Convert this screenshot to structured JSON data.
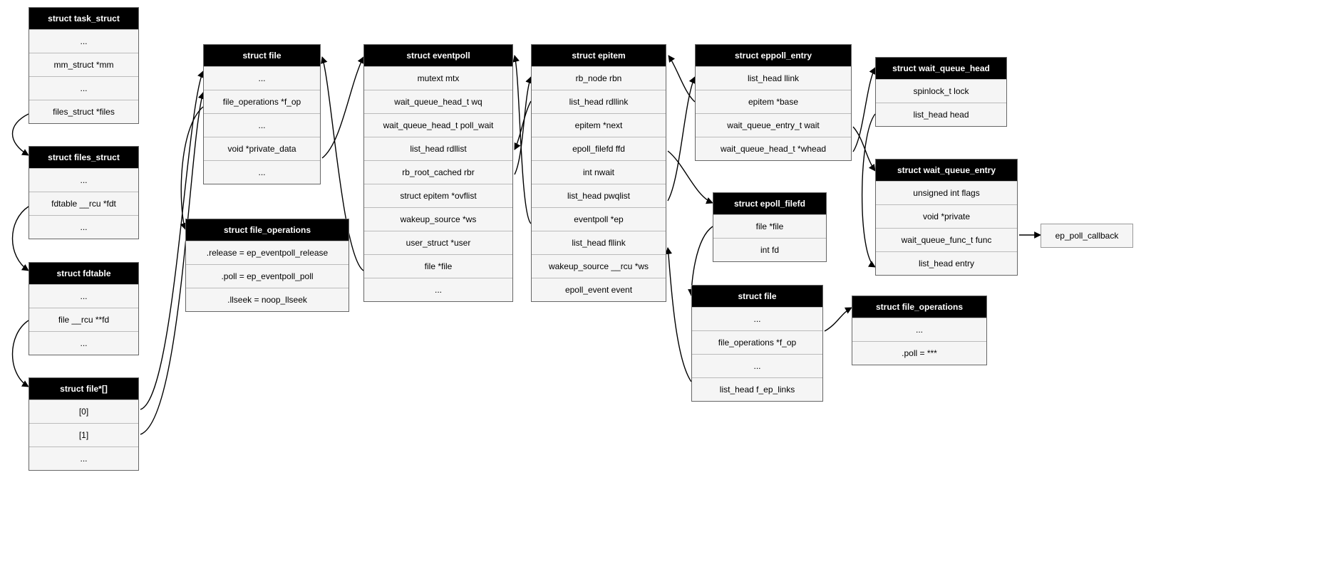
{
  "structs": {
    "task_struct": {
      "title": "struct task_struct",
      "fields": [
        "...",
        "mm_struct *mm",
        "...",
        "files_struct *files"
      ]
    },
    "files_struct": {
      "title": "struct files_struct",
      "fields": [
        "...",
        "fdtable __rcu *fdt",
        "..."
      ]
    },
    "fdtable": {
      "title": "struct fdtable",
      "fields": [
        "...",
        "file __rcu **fd",
        "..."
      ]
    },
    "file_array": {
      "title": "struct file*[]",
      "fields": [
        "[0]",
        "[1]",
        "..."
      ]
    },
    "file_1": {
      "title": "struct file",
      "fields": [
        "...",
        "file_operations *f_op",
        "...",
        "void *private_data",
        "..."
      ]
    },
    "file_operations_1": {
      "title": "struct file_operations",
      "fields": [
        ".release = ep_eventpoll_release",
        ".poll = ep_eventpoll_poll",
        ".llseek = noop_llseek"
      ]
    },
    "eventpoll": {
      "title": "struct eventpoll",
      "fields": [
        "mutext mtx",
        "wait_queue_head_t wq",
        "wait_queue_head_t poll_wait",
        "list_head rdllist",
        "rb_root_cached rbr",
        "struct epitem *ovflist",
        "wakeup_source *ws",
        "user_struct *user",
        "file *file",
        "..."
      ]
    },
    "epitem": {
      "title": "struct epitem",
      "fields": [
        "rb_node rbn",
        "list_head rdllink",
        "epitem *next",
        "epoll_filefd ffd",
        "int nwait",
        "list_head pwqlist",
        "eventpoll *ep",
        "list_head fllink",
        "wakeup_source __rcu *ws",
        "epoll_event event"
      ]
    },
    "eppoll_entry": {
      "title": "struct eppoll_entry",
      "fields": [
        "list_head llink",
        "epitem *base",
        "wait_queue_entry_t wait",
        "wait_queue_head_t *whead"
      ]
    },
    "epoll_filefd": {
      "title": "struct epoll_filefd",
      "fields": [
        "file *file",
        "int fd"
      ]
    },
    "file_2": {
      "title": "struct file",
      "fields": [
        "...",
        "file_operations *f_op",
        "...",
        "list_head f_ep_links"
      ]
    },
    "wait_queue_head": {
      "title": "struct wait_queue_head",
      "fields": [
        "spinlock_t lock",
        "list_head head"
      ]
    },
    "wait_queue_entry": {
      "title": "struct wait_queue_entry",
      "fields": [
        "unsigned int flags",
        "void *private",
        "wait_queue_func_t func",
        "list_head entry"
      ]
    },
    "file_operations_2": {
      "title": "struct file_operations",
      "fields": [
        "...",
        ".poll = ***"
      ]
    }
  },
  "notes": {
    "ep_poll_callback": "ep_poll_callback"
  }
}
